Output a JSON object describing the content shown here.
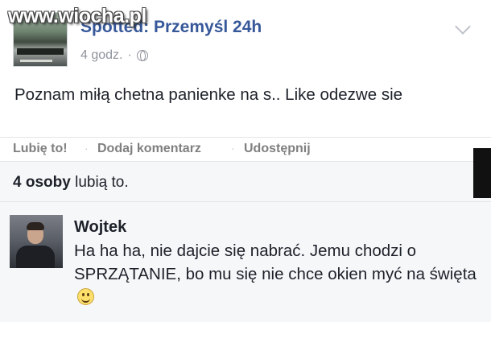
{
  "watermark": "www.wiocha.pl",
  "post": {
    "page_name": "Spotted: Przemyśl 24h",
    "time": "4 godz.",
    "dot": "·",
    "text": "Poznam miłą chetna panienke na s.. Like odezwe sie"
  },
  "actions": {
    "like": "Lubię to!",
    "comment": "Dodaj komentarz",
    "share": "Udostępnij",
    "sep": "·"
  },
  "likes": {
    "count": "4 osoby",
    "suffix": " lubią to."
  },
  "comment": {
    "author": "Wojtek",
    "text": "Ha ha ha, nie dajcie się nabrać. Jemu chodzi o SPRZĄTANIE, bo mu się nie chce okien myć na święta",
    "emoji": "smiley-icon"
  },
  "colors": {
    "link_blue": "#365899",
    "meta_gray": "#90949c",
    "panel_bg": "#f6f7f9"
  }
}
